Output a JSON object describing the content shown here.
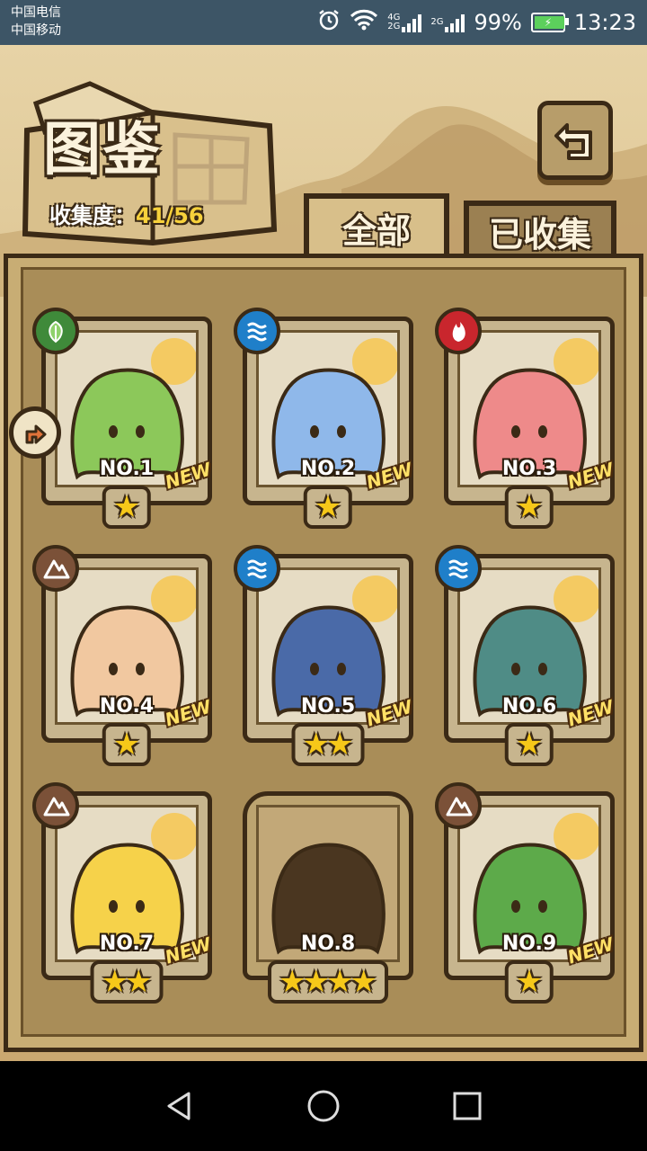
{
  "status_bar": {
    "carrier_1": "中国电信",
    "carrier_2": "中国移动",
    "net_a": "4G",
    "net_b": "2G",
    "net_c": "2G",
    "battery": "99%",
    "battery_level": 0.99,
    "time": "13:23"
  },
  "header": {
    "title": "图鉴",
    "collect_label": "收集度：",
    "collect_value": "41/56"
  },
  "tabs": [
    {
      "label": "全部",
      "active": true
    },
    {
      "label": "已收集",
      "active": false
    }
  ],
  "cards": [
    {
      "no": "NO.1",
      "new": "NEW",
      "stars": 1,
      "element": "grass-icon",
      "body": "#8cc85a",
      "locked": false
    },
    {
      "no": "NO.2",
      "new": "NEW",
      "stars": 1,
      "element": "water-icon",
      "body": "#8fb8ea",
      "locked": false
    },
    {
      "no": "NO.3",
      "new": "NEW",
      "stars": 1,
      "element": "fire-icon",
      "body": "#ee8a8a",
      "locked": false
    },
    {
      "no": "NO.4",
      "new": "NEW",
      "stars": 1,
      "element": "earth-icon",
      "body": "#f1c8a0",
      "locked": false
    },
    {
      "no": "NO.5",
      "new": "NEW",
      "stars": 2,
      "element": "water-icon",
      "body": "#4a6aa8",
      "locked": false
    },
    {
      "no": "NO.6",
      "new": "NEW",
      "stars": 1,
      "element": "water-icon",
      "body": "#4f8c86",
      "locked": false
    },
    {
      "no": "NO.7",
      "new": "NEW",
      "stars": 2,
      "element": "earth-icon",
      "body": "#f6d24a",
      "locked": false
    },
    {
      "no": "NO.8",
      "new": "",
      "stars": 4,
      "element": "",
      "body": "#4a3620",
      "locked": true
    },
    {
      "no": "NO.9",
      "new": "NEW",
      "stars": 1,
      "element": "earth-icon",
      "body": "#5daa4a",
      "locked": false
    }
  ],
  "colors": {
    "star": "#f6c819",
    "outline": "#3b2a16",
    "collect_value": "#f7d13b"
  }
}
